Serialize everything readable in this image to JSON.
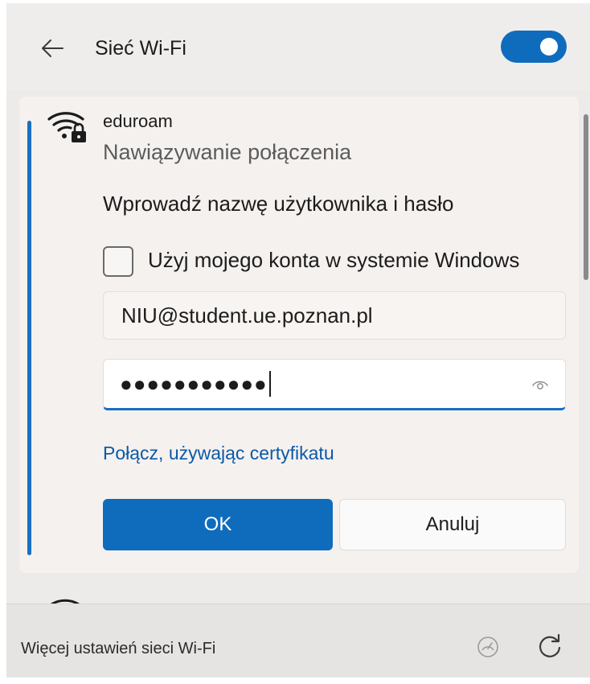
{
  "header": {
    "title": "Sieć Wi-Fi",
    "back_icon": "arrow-left-icon",
    "toggle_on": true,
    "accent_color": "#0f6cbd"
  },
  "network": {
    "icon": "wifi-secured-icon",
    "name": "eduroam",
    "status": "Nawiązywanie połączenia",
    "prompt": "Wprowadź nazwę użytkownika i hasło",
    "use_windows_account_label": "Użyj mojego konta w systemie Windows",
    "use_windows_account_checked": false,
    "username_value": "NIU@student.ue.poznan.pl",
    "password_masked": "●●●●●●●●●●●",
    "reveal_icon": "eye-icon",
    "certificate_link": "Połącz, używając certyfikatu",
    "ok_label": "OK",
    "cancel_label": "Anuluj"
  },
  "footer": {
    "more_settings": "Więcej ustawień sieci Wi-Fi",
    "meter_icon": "meter-icon",
    "refresh_icon": "refresh-icon"
  }
}
